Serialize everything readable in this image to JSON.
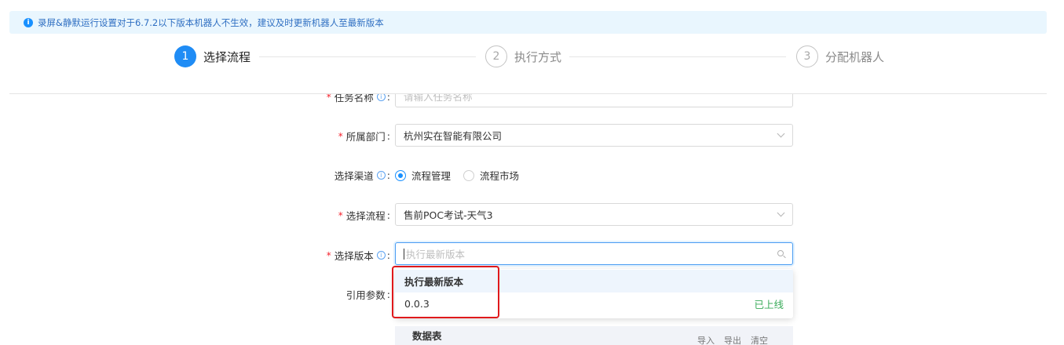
{
  "alert": {
    "text": "录屏&静默运行设置对于6.7.2以下版本机器人不生效，建议及时更新机器人至最新版本",
    "icon": "info-icon"
  },
  "steps": [
    {
      "number": "1",
      "label": "选择流程",
      "state": "active"
    },
    {
      "number": "2",
      "label": "执行方式",
      "state": "inactive"
    },
    {
      "number": "3",
      "label": "分配机器人",
      "state": "inactive"
    }
  ],
  "form": {
    "task_name": {
      "label": "任务名称",
      "required": true,
      "placeholder": "请输入任务名称"
    },
    "department": {
      "label": "所属部门",
      "required": true,
      "value": "杭州实在智能有限公司"
    },
    "channel": {
      "label": "选择渠道",
      "required": false,
      "options": [
        "流程管理",
        "流程市场"
      ],
      "selected": "流程管理"
    },
    "process": {
      "label": "选择流程",
      "required": true,
      "value": "售前POC考试-天气3"
    },
    "version": {
      "label": "选择版本",
      "required": true,
      "placeholder": "执行最新版本"
    },
    "params": {
      "label": "引用参数"
    }
  },
  "version_dropdown": {
    "items": [
      {
        "label": "执行最新版本",
        "status": ""
      },
      {
        "label": "0.0.3",
        "status": "已上线"
      }
    ]
  },
  "data_table": {
    "title": "数据表",
    "actions": [
      "导入",
      "导出",
      "清空"
    ]
  },
  "colors": {
    "primary": "#1890ff",
    "required": "#f5222d",
    "success": "#3aab5a",
    "highlight": "#e0191c"
  }
}
